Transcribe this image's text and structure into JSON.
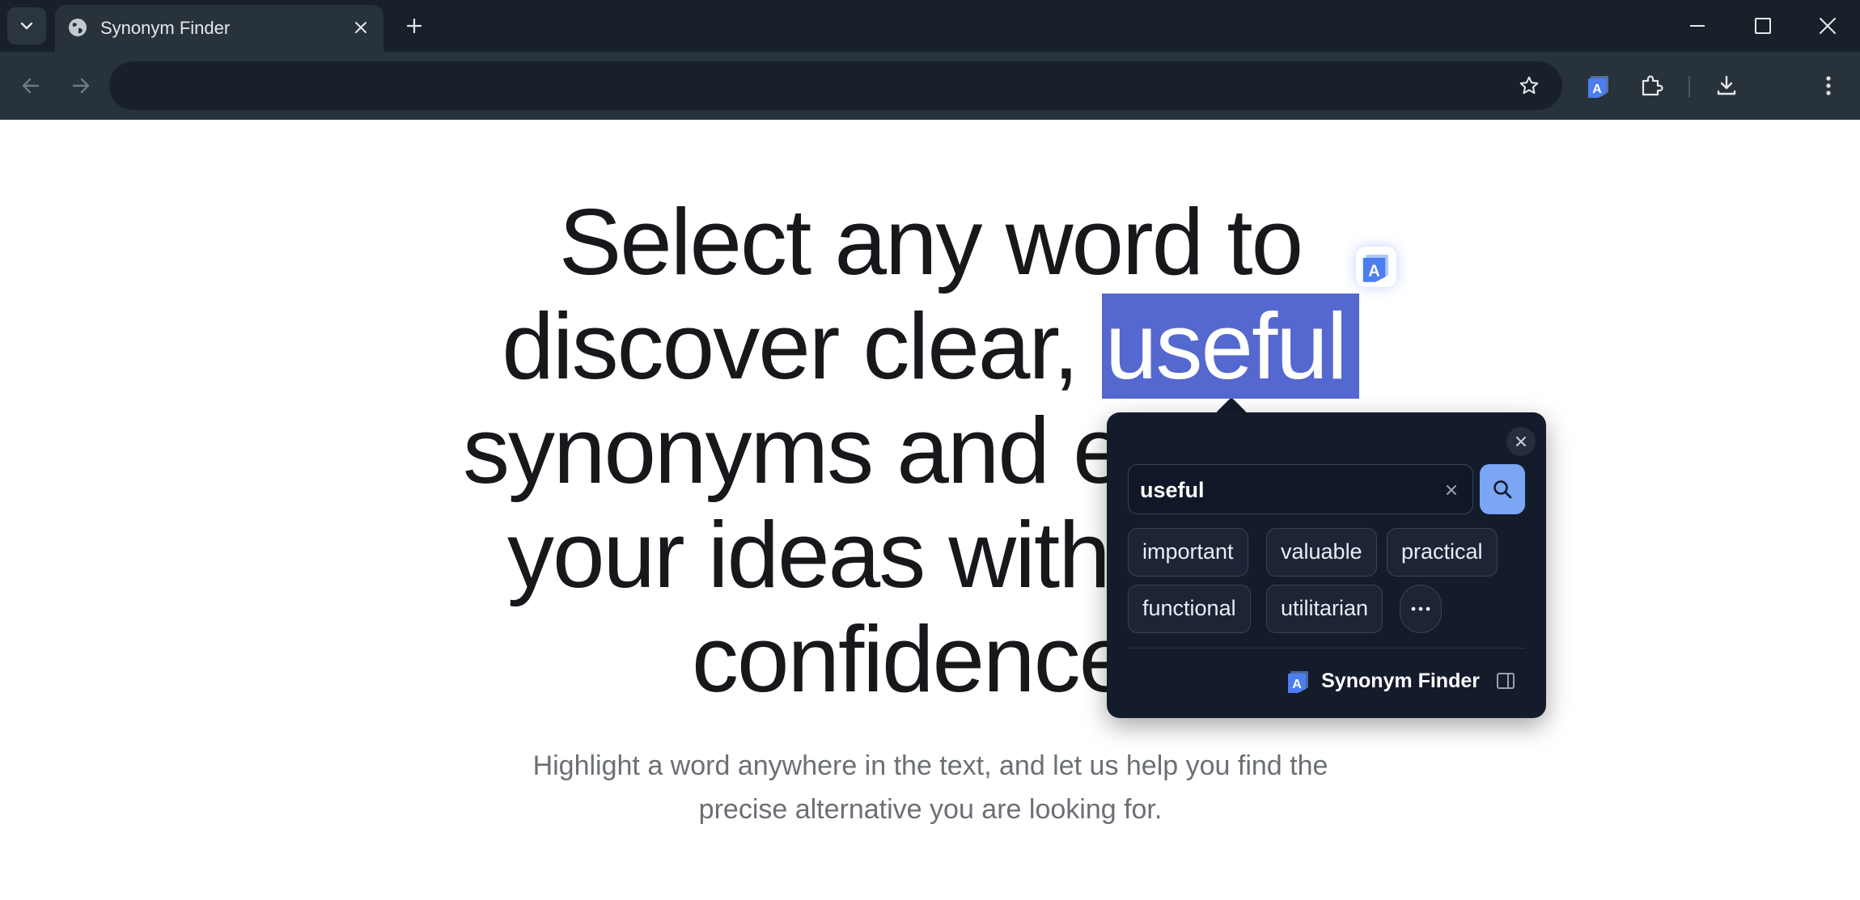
{
  "browser": {
    "tab_title": "Synonym Finder",
    "address_value": ""
  },
  "page": {
    "headline_line1": "Select any word to",
    "headline_line2_prefix": "discover clear, ",
    "headline_highlight": "useful",
    "headline_line3": "synonyms and e",
    "headline_line4": "your ideas with",
    "headline_line5": "confidence",
    "subline_line1": "Highlight a word anywhere in the text, and let us help you find the",
    "subline_line2": "precise alternative you are looking for."
  },
  "popup": {
    "search_value": "useful",
    "synonyms": [
      "important",
      "valuable",
      "practical",
      "functional",
      "utilitarian"
    ],
    "more_label": "···",
    "brand_name": "Synonym Finder",
    "brand_icon_letter": "A"
  },
  "colors": {
    "highlight": "#5568cf",
    "popup_bg": "#141b2b",
    "search_button": "#7aa6f5",
    "extension_icon": "#4d7ef0"
  }
}
